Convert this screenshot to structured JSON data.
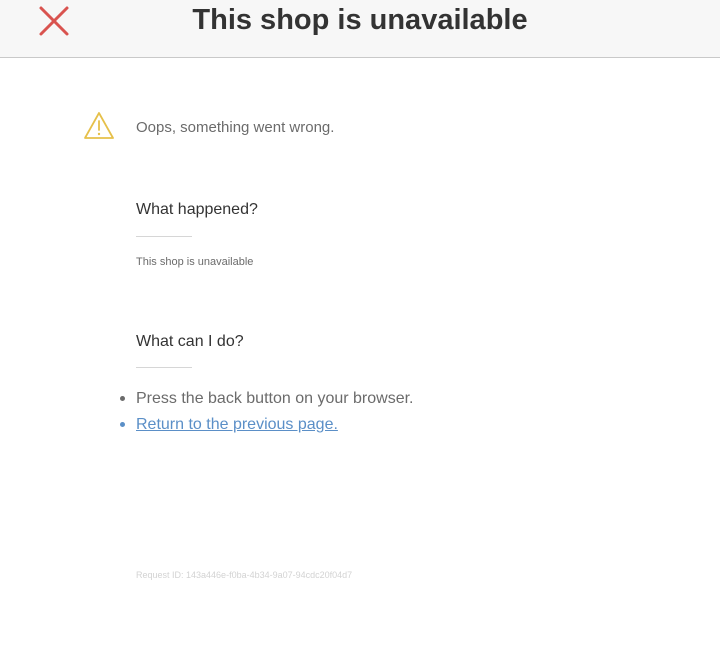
{
  "header": {
    "title": "This shop is unavailable",
    "close_icon": "close-icon"
  },
  "main": {
    "warning_icon": "warning-icon",
    "message": "Oops, something went wrong.",
    "what_happened": {
      "heading": "What happened?",
      "text": "This shop is unavailable"
    },
    "what_can_i_do": {
      "heading": "What can I do?",
      "items": [
        "Press the back button on your browser.",
        "Return to the previous page."
      ]
    },
    "request_id": "Request ID: 143a446e-f0ba-4b34-9a07-94cdc20f04d7"
  },
  "colors": {
    "close": "#d9534f",
    "warning": "#e6c04a",
    "link": "#5b8fc7"
  }
}
